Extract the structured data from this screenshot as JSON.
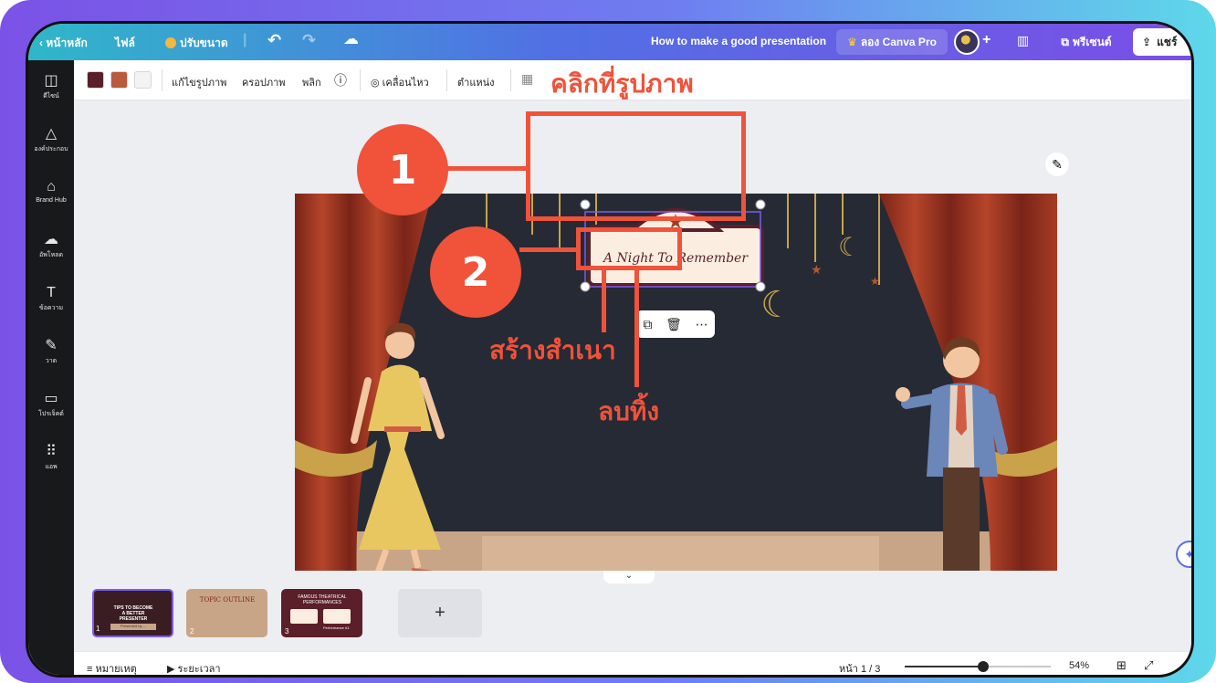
{
  "topbar": {
    "back_label": "หน้าหลัก",
    "file_label": "ไฟล์",
    "resize_label": "ปรับขนาด",
    "doc_title": "How to make a good presentation",
    "try_pro_label": "ลอง Canva Pro",
    "present_label": "พรีเซนต์",
    "share_label": "แชร์",
    "add_label": "+"
  },
  "sidebar": {
    "items": [
      {
        "label": "ดีไซน์",
        "icon": "layout-icon"
      },
      {
        "label": "องค์ประกอบ",
        "icon": "shapes-icon"
      },
      {
        "label": "Brand Hub",
        "icon": "brand-icon"
      },
      {
        "label": "อัพโหลด",
        "icon": "cloud-upload-icon"
      },
      {
        "label": "ข้อความ",
        "icon": "text-icon"
      },
      {
        "label": "วาด",
        "icon": "pen-icon"
      },
      {
        "label": "โปรเจ็คต์",
        "icon": "folder-icon"
      },
      {
        "label": "แอพ",
        "icon": "apps-icon"
      }
    ]
  },
  "toolbar": {
    "colors": [
      "#5a1f28",
      "#b95a3c",
      "#f3f3f3"
    ],
    "edit_image": "แก้ไขรูปภาพ",
    "crop": "ครอปภาพ",
    "flip": "พลิก",
    "animate": "เคลื่อนไหว",
    "position": "ตำแหน่ง"
  },
  "annotations": {
    "click_image": "คลิกที่รูปภาพ",
    "step1": "1",
    "step2": "2",
    "duplicate": "สร้างสำเนา",
    "delete": "ลบทิ้ง",
    "accent_color": "#f0523a"
  },
  "slide": {
    "sign_text": "A Night To Remember"
  },
  "thumbnails": [
    {
      "num": "1",
      "title": "TIPS TO BECOME A BETTER PRESENTER",
      "sub": "Presented by ..."
    },
    {
      "num": "2",
      "title": "TOPIC OUTLINE",
      "sub": ""
    },
    {
      "num": "3",
      "title": "FAMOUS THEATRICAL PERFORMANCES",
      "sub": "Performance #1"
    }
  ],
  "statusbar": {
    "notes": "หมายเหตุ",
    "duration": "ระยะเวลา",
    "page": "หน้า 1 / 3",
    "zoom": "54%",
    "zoom_level": 0.54
  }
}
